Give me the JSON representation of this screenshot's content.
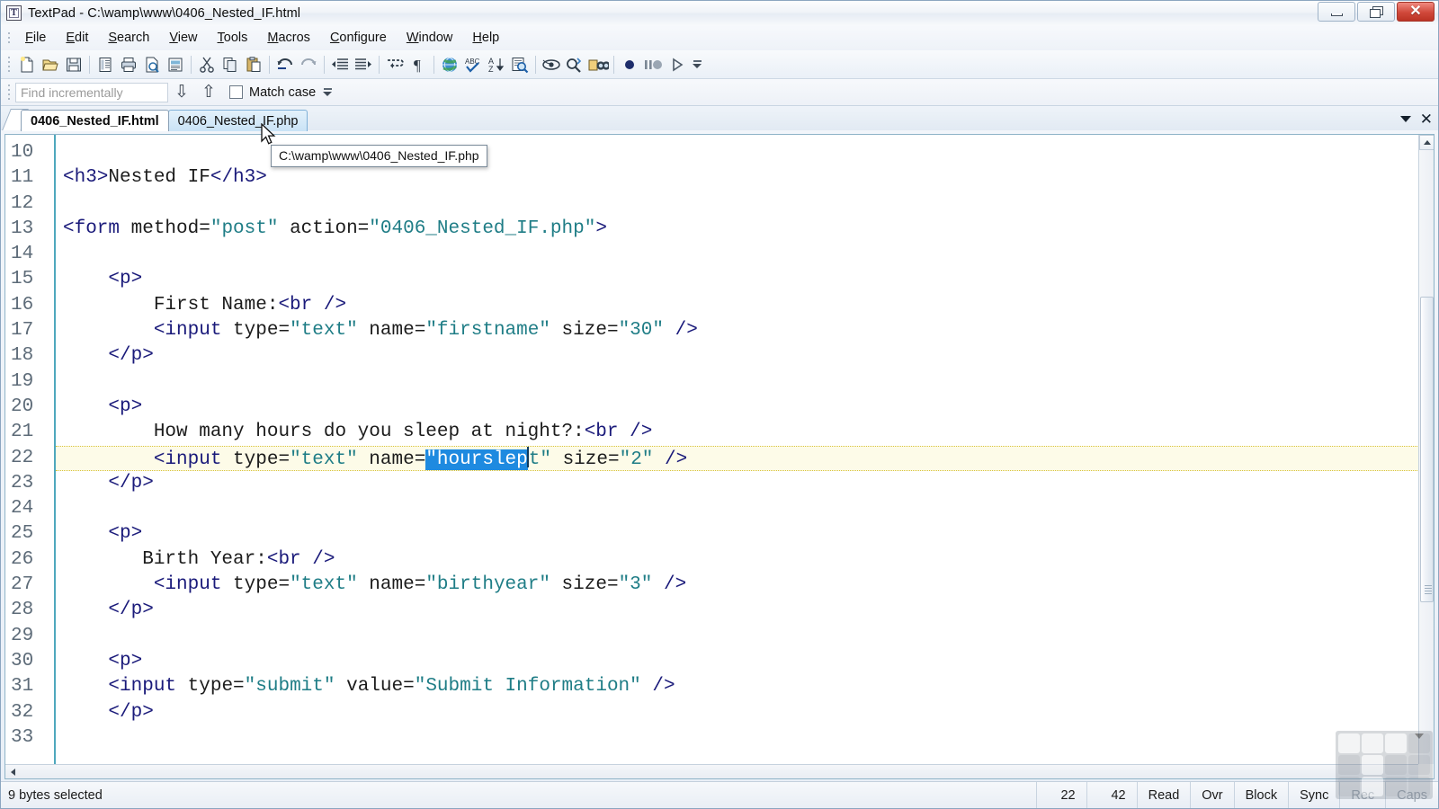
{
  "window": {
    "title": "TextPad - C:\\wamp\\www\\0406_Nested_IF.html",
    "app_icon": "textpad-icon",
    "minimize_label": "",
    "restore_label": "",
    "close_label": "✕"
  },
  "menubar": {
    "items": [
      {
        "label": "File",
        "accel": "F"
      },
      {
        "label": "Edit",
        "accel": "E"
      },
      {
        "label": "Search",
        "accel": "S"
      },
      {
        "label": "View",
        "accel": "V"
      },
      {
        "label": "Tools",
        "accel": "T"
      },
      {
        "label": "Macros",
        "accel": "M"
      },
      {
        "label": "Configure",
        "accel": "C"
      },
      {
        "label": "Window",
        "accel": "W"
      },
      {
        "label": "Help",
        "accel": "H"
      }
    ]
  },
  "toolbar": {
    "buttons": [
      "new-file-icon",
      "open-file-icon",
      "save-file-icon",
      "file-properties-icon",
      "print-icon",
      "print-preview-icon",
      "document-view-icon",
      "cut-icon",
      "copy-icon",
      "paste-icon",
      "undo-icon",
      "redo-icon",
      "decrease-indent-icon",
      "increase-indent-icon",
      "word-wrap-icon",
      "show-paragraph-marks-icon",
      "browser-preview-icon",
      "spell-check-icon",
      "sort-icon",
      "find-in-files-icon",
      "show-spaces-icon",
      "find-replace-icon",
      "compare-files-icon",
      "macro-record-icon",
      "macro-pause-icon",
      "macro-play-icon"
    ],
    "overflow_label": "toolbar-overflow-chevron"
  },
  "findbar": {
    "placeholder": "Find incrementally",
    "value": "",
    "find-next-icon": "arrow-down-icon",
    "find-prev-icon": "arrow-up-icon",
    "match_case_label": "Match case",
    "match_case_checked": false
  },
  "tabs": {
    "items": [
      {
        "label": "0406_Nested_IF.html",
        "active": true,
        "hovered": false
      },
      {
        "label": "0406_Nested_IF.php",
        "active": false,
        "hovered": true
      }
    ],
    "list_icon": "chevron-down-icon",
    "close_icon": "✕"
  },
  "tooltip": {
    "text": "C:\\wamp\\www\\0406_Nested_IF.php"
  },
  "editor": {
    "first_line": 10,
    "lines": [
      {
        "n": 10,
        "text": ""
      },
      {
        "n": 11,
        "text": "<h3>Nested IF</h3>"
      },
      {
        "n": 12,
        "text": ""
      },
      {
        "n": 13,
        "text": "<form method=\"post\" action=\"0406_Nested_IF.php\">"
      },
      {
        "n": 14,
        "text": ""
      },
      {
        "n": 15,
        "text": "    <p>"
      },
      {
        "n": 16,
        "text": "        First Name:<br />"
      },
      {
        "n": 17,
        "text": "        <input type=\"text\" name=\"firstname\" size=\"30\" />"
      },
      {
        "n": 18,
        "text": "    </p>"
      },
      {
        "n": 19,
        "text": ""
      },
      {
        "n": 20,
        "text": "    <p>"
      },
      {
        "n": 21,
        "text": "        How many hours do you sleep at night?:<br />"
      },
      {
        "n": 22,
        "text": "        <input type=\"text\" name=\"hourslept\" size=\"2\" />"
      },
      {
        "n": 23,
        "text": "    </p>"
      },
      {
        "n": 24,
        "text": ""
      },
      {
        "n": 25,
        "text": "    <p>"
      },
      {
        "n": 26,
        "text": "       Birth Year:<br />"
      },
      {
        "n": 27,
        "text": "        <input type=\"text\" name=\"birthyear\" size=\"3\" />"
      },
      {
        "n": 28,
        "text": "    </p>"
      },
      {
        "n": 29,
        "text": ""
      },
      {
        "n": 30,
        "text": "    <p>"
      },
      {
        "n": 31,
        "text": "    <input type=\"submit\" value=\"Submit Information\" />"
      },
      {
        "n": 32,
        "text": "    </p>"
      },
      {
        "n": 33,
        "text": ""
      }
    ],
    "current_line": 22,
    "selection_text": "\"hourslep",
    "colors": {
      "tag": "#1a1a7a",
      "string": "#1f7d86",
      "selection_bg": "#1e8ae0",
      "current_line_bg": "#fdfbe8",
      "current_line_border": "#d8c23a",
      "gutter_rule": "#4fa8bd",
      "line_number": "#5d6b78"
    }
  },
  "statusbar": {
    "message": "9 bytes selected",
    "line": "22",
    "column": "42",
    "cells": [
      {
        "label": "Read",
        "dim": false
      },
      {
        "label": "Ovr",
        "dim": false
      },
      {
        "label": "Block",
        "dim": false
      },
      {
        "label": "Sync",
        "dim": false
      },
      {
        "label": "Rec",
        "dim": true
      },
      {
        "label": "Caps",
        "dim": true
      }
    ]
  }
}
